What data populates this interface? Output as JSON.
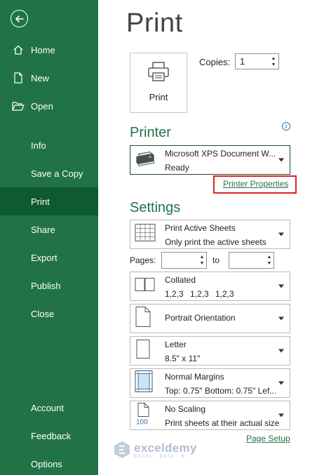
{
  "sidebar": {
    "top_items": [
      {
        "label": "Home",
        "icon": "home-icon"
      },
      {
        "label": "New",
        "icon": "new-document-icon"
      },
      {
        "label": "Open",
        "icon": "folder-open-icon"
      }
    ],
    "items": [
      {
        "label": "Info"
      },
      {
        "label": "Save a Copy"
      },
      {
        "label": "Print",
        "active": true
      },
      {
        "label": "Share"
      },
      {
        "label": "Export"
      },
      {
        "label": "Publish"
      },
      {
        "label": "Close"
      }
    ],
    "bottom_items": [
      {
        "label": "Account"
      },
      {
        "label": "Feedback"
      },
      {
        "label": "Options"
      }
    ],
    "colors": {
      "background": "#217346",
      "active": "#0f5a30"
    }
  },
  "main": {
    "title": "Print",
    "print_button_label": "Print",
    "copies": {
      "label": "Copies:",
      "value": "1"
    },
    "printer": {
      "section_title": "Printer",
      "name": "Microsoft XPS Document W...",
      "status": "Ready",
      "properties_link": "Printer Properties"
    },
    "settings": {
      "section_title": "Settings",
      "active_sheets": {
        "title": "Print Active Sheets",
        "subtitle": "Only print the active sheets"
      },
      "pages": {
        "label": "Pages:",
        "from": "",
        "to_label": "to",
        "to": ""
      },
      "collated": {
        "title": "Collated",
        "subtitle_parts": [
          "1,2,3",
          "1,2,3",
          "1,2,3"
        ]
      },
      "orientation": {
        "title": "Portrait Orientation"
      },
      "paper": {
        "title": "Letter",
        "subtitle": "8.5\" x 11\""
      },
      "margins": {
        "title": "Normal Margins",
        "subtitle": "Top: 0.75\" Bottom: 0.75\" Lef..."
      },
      "scaling": {
        "title": "No Scaling",
        "subtitle": "Print sheets at their actual size",
        "icon_text": "100"
      },
      "page_setup_link": "Page Setup"
    },
    "accent_color": "#217346"
  },
  "watermark": {
    "name": "exceldemy",
    "tagline": "EXCEL · DATA · BI"
  }
}
